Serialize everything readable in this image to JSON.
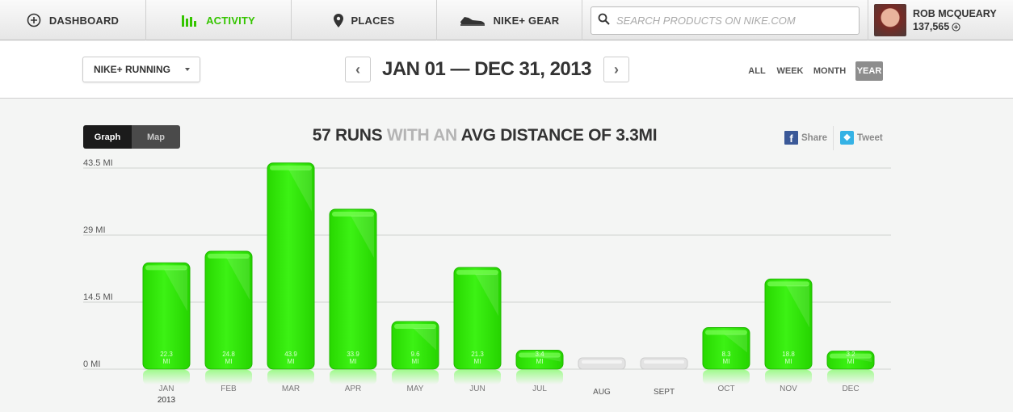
{
  "nav": {
    "items": [
      {
        "label": "DASHBOARD",
        "icon": "plus-circle-icon",
        "active": false
      },
      {
        "label": "ACTIVITY",
        "icon": "bars-icon",
        "active": true
      },
      {
        "label": "PLACES",
        "icon": "map-pin-icon",
        "active": false
      },
      {
        "label": "NIKE+ GEAR",
        "icon": "shoe-icon",
        "active": false
      }
    ],
    "search_placeholder": "SEARCH PRODUCTS ON NIKE.COM",
    "user_name": "ROB MCQUEARY",
    "user_points": "137,565"
  },
  "filter": {
    "activity_select": "NIKE+ RUNNING",
    "date_range": "JAN 01 — DEC 31, 2013",
    "prev_label": "‹",
    "next_label": "›",
    "ranges": [
      {
        "label": "ALL",
        "active": false
      },
      {
        "label": "WEEK",
        "active": false
      },
      {
        "label": "MONTH",
        "active": false
      },
      {
        "label": "YEAR",
        "active": true
      }
    ]
  },
  "view_toggle": {
    "graph": "Graph",
    "map": "Map"
  },
  "headline": {
    "part1": "57 RUNS",
    "part2": " WITH AN ",
    "part3": "AVG DISTANCE OF 3.3MI"
  },
  "social": {
    "share": "Share",
    "tweet": "Tweet"
  },
  "colors": {
    "accent": "#35c500",
    "bar": "#2fe80a",
    "empty_bar": "#dddddd"
  },
  "chart_data": {
    "type": "bar",
    "categories": [
      "JAN",
      "FEB",
      "MAR",
      "APR",
      "MAY",
      "JUN",
      "JUL",
      "AUG",
      "SEPT",
      "OCT",
      "NOV",
      "DEC"
    ],
    "values": [
      22.3,
      24.8,
      43.9,
      33.9,
      9.6,
      21.3,
      3.4,
      0,
      0,
      8.3,
      18.8,
      3.2
    ],
    "value_labels": [
      "22.3",
      "24.8",
      "43.9",
      "33.9",
      "9.6",
      "21.3",
      "3.4",
      "",
      "",
      "8.3",
      "18.8",
      "3.2"
    ],
    "unit_label": "MI",
    "y_ticks": [
      "43.5 MI",
      "29 MI",
      "14.5 MI",
      "0 MI"
    ],
    "y_tick_values": [
      43.5,
      29,
      14.5,
      0
    ],
    "year_label": "2013",
    "ylim": [
      0,
      43.5
    ],
    "grid": true
  }
}
